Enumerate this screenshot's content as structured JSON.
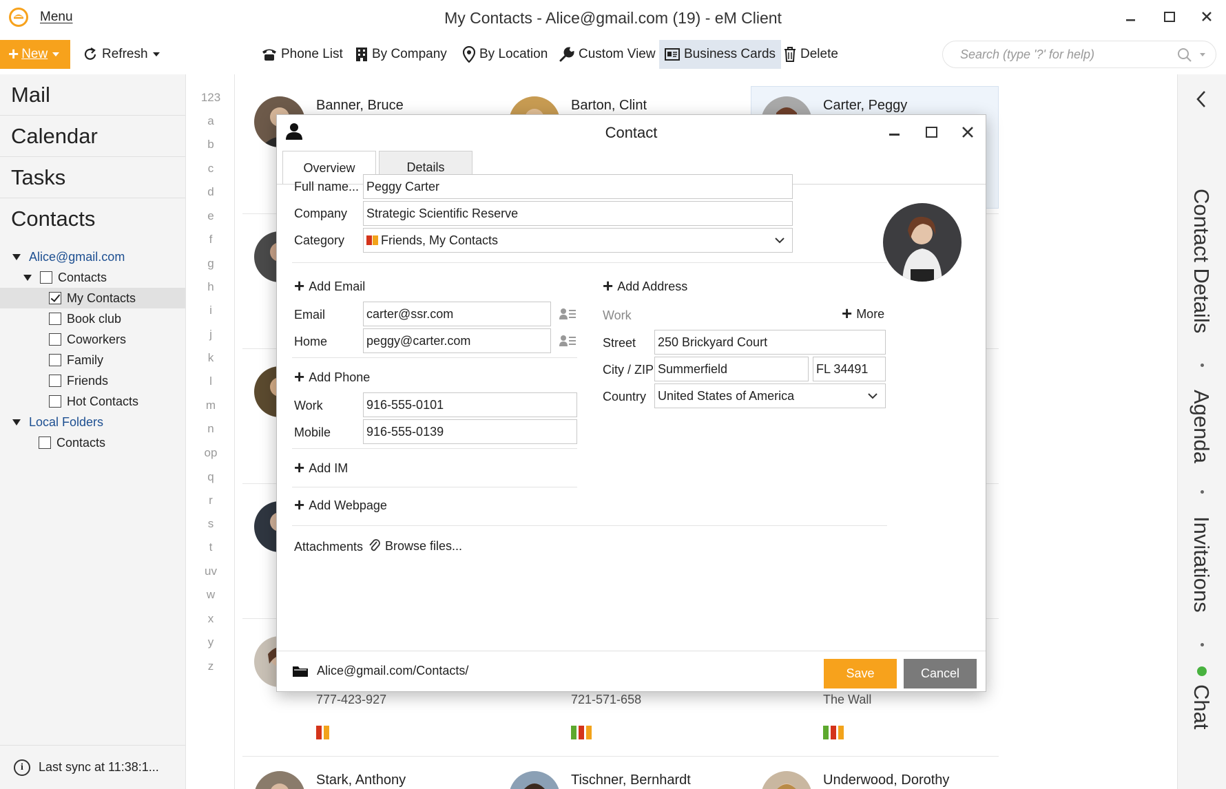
{
  "titlebar": {
    "menu_label": "Menu",
    "window_title": "My Contacts - Alice@gmail.com (19) - eM Client"
  },
  "toolbar": {
    "new_label": "New",
    "refresh_label": "Refresh",
    "views": [
      "Phone List",
      "By Company",
      "By Location",
      "Custom View",
      "Business Cards"
    ],
    "active_view": "Business Cards",
    "delete_label": "Delete",
    "search_placeholder": "Search (type '?' for help)"
  },
  "nav": {
    "sections": [
      "Mail",
      "Calendar",
      "Tasks",
      "Contacts"
    ],
    "account": "Alice@gmail.com",
    "contacts_root": "Contacts",
    "groups": [
      {
        "label": "My Contacts",
        "checked": true
      },
      {
        "label": "Book club",
        "checked": false
      },
      {
        "label": "Coworkers",
        "checked": false
      },
      {
        "label": "Family",
        "checked": false
      },
      {
        "label": "Friends",
        "checked": false
      },
      {
        "label": "Hot Contacts",
        "checked": false
      }
    ],
    "local_folders": "Local Folders",
    "local_contacts": "Contacts",
    "sync_status": "Last sync at 11:38:1..."
  },
  "alphabet": [
    "123",
    "a",
    "b",
    "c",
    "d",
    "e",
    "f",
    "g",
    "h",
    "i",
    "j",
    "k",
    "l",
    "m",
    "n",
    "op",
    "q",
    "r",
    "s",
    "t",
    "uv",
    "w",
    "x",
    "y",
    "z"
  ],
  "cards": {
    "top": [
      "Banner, Bruce",
      "Barton, Clint",
      "Carter, Peggy"
    ],
    "lower_info": [
      "777-423-927",
      "721-571-658",
      "The Wall"
    ],
    "bottom": [
      "Stark, Anthony",
      "Tischner, Bernhardt",
      "Underwood, Dorothy"
    ],
    "category_colors": {
      "orange": "#e8731e",
      "red": "#d4341b",
      "amber": "#f2a31b",
      "green": "#5da92e"
    }
  },
  "right_panel": {
    "items": [
      "Contact Details",
      "Agenda",
      "Invitations",
      "Chat"
    ]
  },
  "dialog": {
    "title": "Contact",
    "tabs": [
      "Overview",
      "Details"
    ],
    "active_tab": "Overview",
    "full_name_label": "Full name...",
    "full_name": "Peggy Carter",
    "company_label": "Company",
    "company": "Strategic Scientific Reserve",
    "category_label": "Category",
    "category": "Friends, My Contacts",
    "add_email": "Add Email",
    "emails": [
      {
        "label": "Email",
        "value": "carter@ssr.com"
      },
      {
        "label": "Home",
        "value": "peggy@carter.com"
      }
    ],
    "add_phone": "Add Phone",
    "phones": [
      {
        "label": "Work",
        "value": "916-555-0101"
      },
      {
        "label": "Mobile",
        "value": "916-555-0139"
      }
    ],
    "add_im": "Add IM",
    "add_webpage": "Add Webpage",
    "add_address": "Add Address",
    "address_type": "Work",
    "more_label": "More",
    "street_label": "Street",
    "street": "250 Brickyard Court",
    "city_zip_label": "City / ZIP",
    "city": "Summerfield",
    "zip": "FL 34491",
    "country_label": "Country",
    "country": "United States of America",
    "attachments_label": "Attachments",
    "browse_label": "Browse files...",
    "folder_path": "Alice@gmail.com/Contacts/",
    "save_label": "Save",
    "cancel_label": "Cancel"
  },
  "colors": {
    "accent": "#f7a21c",
    "link_blue": "#1d4f91",
    "cancel_gray": "#7a7a7a"
  }
}
